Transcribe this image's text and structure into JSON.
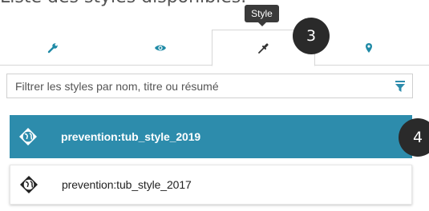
{
  "heading": {
    "text": "Liste des styles disponibles."
  },
  "tooltip": {
    "text": "Style"
  },
  "tabs": [
    {
      "icon": "wrench-icon",
      "active": false
    },
    {
      "icon": "eye-icon",
      "active": false
    },
    {
      "icon": "eyedropper-icon",
      "active": true
    },
    {
      "icon": "map-marker-icon",
      "active": false
    }
  ],
  "badges": {
    "step3": "3",
    "step4": "4"
  },
  "filter": {
    "placeholder": "Filtrer les styles par nom, titre ou résumé",
    "value": ""
  },
  "styles": [
    {
      "name": "prevention:tub_style_2019",
      "selected": true
    },
    {
      "name": "prevention:tub_style_2017",
      "selected": false
    }
  ],
  "colors": {
    "accent": "#2d8cac",
    "tab_icon": "#1f8aa6",
    "badge": "#2a2a2a"
  }
}
